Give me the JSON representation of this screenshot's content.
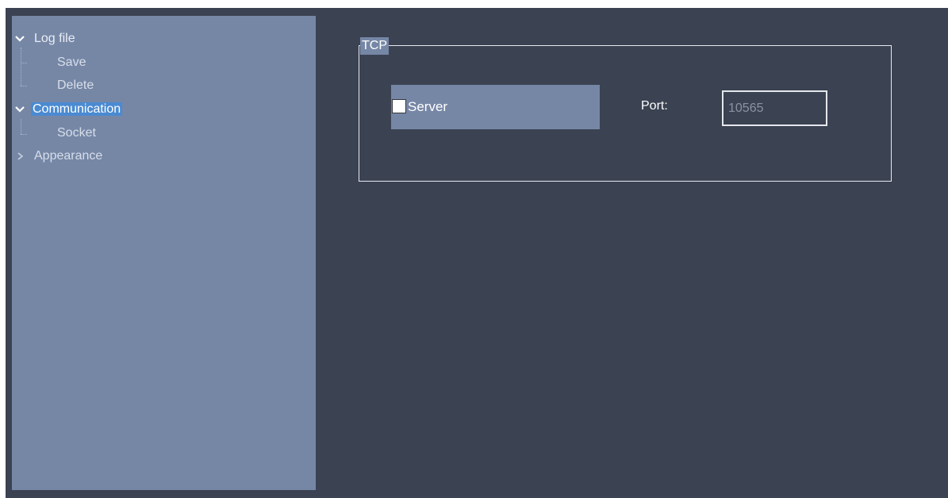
{
  "tree": {
    "items": [
      {
        "label": "Log file",
        "expanded": true,
        "icon": "chevron-down-icon"
      },
      {
        "label": "Save"
      },
      {
        "label": "Delete"
      },
      {
        "label": "Communication",
        "expanded": true,
        "selected": true,
        "icon": "chevron-down-icon"
      },
      {
        "label": "Socket"
      },
      {
        "label": "Appearance",
        "expanded": false,
        "icon": "chevron-right-icon"
      }
    ]
  },
  "tcp": {
    "title": "TCP",
    "server_label": "Server",
    "server_checked": false,
    "port_label": "Port:",
    "port_value": "10565"
  },
  "colors": {
    "background": "#3b4252",
    "panel": "#7687a6",
    "selection": "#4a8ad1"
  }
}
